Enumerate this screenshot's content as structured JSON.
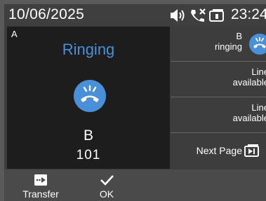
{
  "status_bar": {
    "date": "10/06/2025",
    "time": "23:24",
    "icons": [
      "speaker-icon",
      "missed-call-icon",
      "voicemail-icon"
    ]
  },
  "call": {
    "line": "A",
    "status": "Ringing",
    "name": "B",
    "number": "101",
    "accent_color": "#4a90d9"
  },
  "line_keys": [
    {
      "line1": "B",
      "line2": "ringing",
      "icon": "ringing-call-icon"
    },
    {
      "line1": "Line",
      "line2": "available"
    },
    {
      "line1": "Line",
      "line2": "available"
    },
    {
      "label": "Next Page",
      "icon": "next-page-icon"
    }
  ],
  "softkeys": [
    {
      "label": "Transfer",
      "icon": "transfer-icon"
    },
    {
      "label": "OK",
      "icon": "checkmark-icon"
    }
  ]
}
